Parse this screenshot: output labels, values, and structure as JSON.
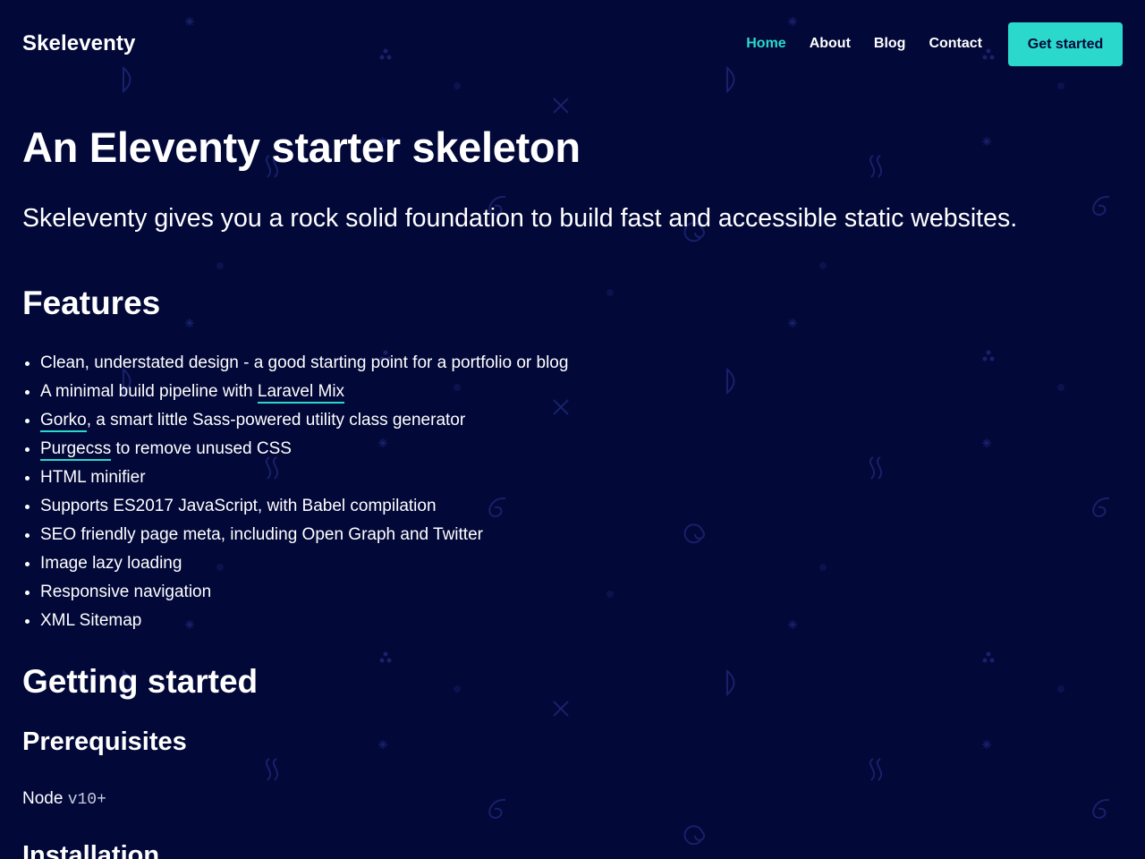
{
  "header": {
    "logo": "Skeleventy",
    "nav": [
      "Home",
      "About",
      "Blog",
      "Contact"
    ],
    "cta": "Get started"
  },
  "main": {
    "title": "An Eleventy starter skeleton",
    "lead": "Skeleventy gives you a rock solid foundation to build fast and accessible static websites.",
    "features_heading": "Features",
    "features": [
      {
        "text": "Clean, understated design - a good starting point for a portfolio or blog"
      },
      {
        "before": "A minimal build pipeline with ",
        "link": "Laravel Mix",
        "after": ""
      },
      {
        "before": "",
        "link": "Gorko",
        "after": ", a smart little Sass-powered utility class generator"
      },
      {
        "before": "",
        "link": "Purgecss",
        "after": " to remove unused CSS"
      },
      {
        "text": "HTML minifier"
      },
      {
        "text": "Supports ES2017 JavaScript, with Babel compilation"
      },
      {
        "text": "SEO friendly page meta, including Open Graph and Twitter"
      },
      {
        "text": "Image lazy loading"
      },
      {
        "text": "Responsive navigation"
      },
      {
        "text": "XML Sitemap"
      }
    ],
    "getting_started_heading": "Getting started",
    "prerequisites_heading": "Prerequisites",
    "node_label": "Node",
    "node_version": "v10+",
    "installation_heading": "Installation"
  },
  "colors": {
    "background": "#020838",
    "accent": "#2ad9cc",
    "text": "#ffffff"
  }
}
